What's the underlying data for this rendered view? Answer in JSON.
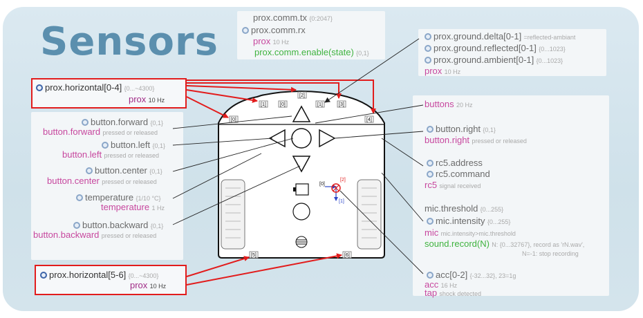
{
  "title": "Sensors",
  "comm": {
    "tx": "prox.comm.tx",
    "tx_range": "{0:2047}",
    "rx": "prox.comm.rx",
    "event": "prox",
    "event_rate": "10 Hz",
    "enable": "prox.comm.enable(state)",
    "enable_range": "{0,1}"
  },
  "ground": {
    "delta": "prox.ground.delta[0-1]",
    "delta_note": "=reflected-ambiant",
    "reflected": "prox.ground.reflected[0-1]",
    "reflected_range": "{0...1023}",
    "ambient": "prox.ground.ambient[0-1]",
    "ambient_range": "{0...1023}",
    "event": "prox",
    "event_rate": "10 Hz"
  },
  "horizontal_front": {
    "name": "prox.horizontal[0-4]",
    "range": "{0...~4300}",
    "event": "prox",
    "event_rate": "10 Hz"
  },
  "horizontal_back": {
    "name": "prox.horizontal[5-6]",
    "range": "{0...~4300}",
    "event": "prox",
    "event_rate": "10 Hz"
  },
  "left_panel": {
    "forward": "button.forward",
    "forward_range": "{0,1}",
    "forward_event": "button.forward",
    "forward_note": "pressed or released",
    "left": "button.left",
    "left_range": "{0,1}",
    "left_event": "button.left",
    "left_note": "pressed or released",
    "center": "button.center",
    "center_range": "{0,1}",
    "center_event": "button.center",
    "center_note": "pressed or released",
    "temperature": "temperature",
    "temperature_range": "{1/10 °C}",
    "temperature_event": "temperature",
    "temperature_rate": "1 Hz",
    "backward": "button.backward",
    "backward_range": "{0,1}",
    "backward_event": "button.backward",
    "backward_note": "pressed or released"
  },
  "right_panel": {
    "buttons": "buttons",
    "buttons_rate": "20 Hz",
    "right": "button.right",
    "right_range": "{0,1}",
    "right_event": "button.right",
    "right_note": "pressed or released",
    "rc5_address": "rc5.address",
    "rc5_command": "rc5.command",
    "rc5_event": "rc5",
    "rc5_note": "signal received",
    "mic_threshold": "mic.threshold",
    "mic_threshold_range": "{0...255}",
    "mic_intensity": "mic.intensity",
    "mic_intensity_range": "{0...255}",
    "mic_event": "mic",
    "mic_note": "mic.intensity>mic.threshold",
    "sound": "sound.record(N)",
    "sound_note1": "N: {0...32767}, record as 'rN.wav',",
    "sound_note2": "N=-1: stop recording",
    "acc": "acc[0-2]",
    "acc_range": "{-32...32}, 23=1g",
    "acc_event": "acc",
    "acc_rate": "16 Hz",
    "tap_event": "tap",
    "tap_note": "shock detected"
  },
  "robot": {
    "front_sensor_labels": [
      "[0]",
      "[1]",
      "[2]",
      "[3]",
      "[4]"
    ],
    "ground_labels": [
      "[0]",
      "[1]"
    ],
    "back_sensor_labels": [
      "[5]",
      "[6]"
    ],
    "axis_labels": [
      "[0]",
      "[2]",
      "[1]"
    ]
  },
  "colors": {
    "highlight": "#e21c1c",
    "title": "#5b8fae",
    "event": "#c7479e",
    "function": "#3fb33f",
    "background": "#d3e4ec"
  }
}
